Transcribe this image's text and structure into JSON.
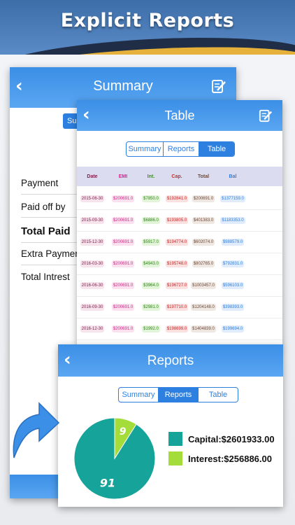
{
  "banner": {
    "title": "Explicit Reports"
  },
  "summary": {
    "title": "Summary",
    "tab_partial": "Su",
    "rows": [
      "Payment",
      "Paid off by",
      "Total Paid",
      "Extra Paymer",
      "Total Intrest"
    ]
  },
  "table": {
    "title": "Table",
    "segments": [
      "Summary",
      "Reports",
      "Table"
    ],
    "active_segment": "Table",
    "headers": [
      "Date",
      "EMI",
      "Int.",
      "Cap.",
      "Total",
      "Bal"
    ],
    "header_colors": [
      "#7a1f4a",
      "#d9248a",
      "#3a8f1f",
      "#d42a2a",
      "#6b4a3a",
      "#2d7fe0"
    ],
    "rows": [
      [
        "2015-06-30",
        "$200691.0",
        "$7850.0",
        "$192841.0",
        "$200691.0",
        "$1377159.0"
      ],
      [
        "2015-09-30",
        "$200691.0",
        "$6886.0",
        "$193805.0",
        "$401383.0",
        "$1183353.0"
      ],
      [
        "2015-12-30",
        "$200691.0",
        "$5917.0",
        "$194774.0",
        "$602074.0",
        "$988579.0"
      ],
      [
        "2016-03-30",
        "$200691.0",
        "$4943.0",
        "$195748.0",
        "$802765.0",
        "$792831.0"
      ],
      [
        "2016-06-30",
        "$200691.0",
        "$3964.0",
        "$196727.0",
        "$1003457.0",
        "$596103.0"
      ],
      [
        "2016-09-30",
        "$200691.0",
        "$2981.0",
        "$197710.0",
        "$1204148.0",
        "$398393.0"
      ],
      [
        "2016-12-30",
        "$200691.0",
        "$1992.0",
        "$198699.0",
        "$1404839.0",
        "$199694.0"
      ]
    ]
  },
  "reports": {
    "title": "Reports",
    "segments": [
      "Summary",
      "Reports",
      "Table"
    ],
    "active_segment": "Reports",
    "legend": [
      {
        "label": "Capital:$2601933.00",
        "color": "#15a39a"
      },
      {
        "label": "Interest:$256886.00",
        "color": "#a4dc3a"
      }
    ]
  },
  "chart_data": {
    "type": "pie",
    "slices": [
      {
        "name": "Capital",
        "value": 91,
        "color": "#15a39a"
      },
      {
        "name": "Interest",
        "value": 9,
        "color": "#a4dc3a"
      }
    ],
    "labels": [
      "91",
      "9"
    ]
  }
}
